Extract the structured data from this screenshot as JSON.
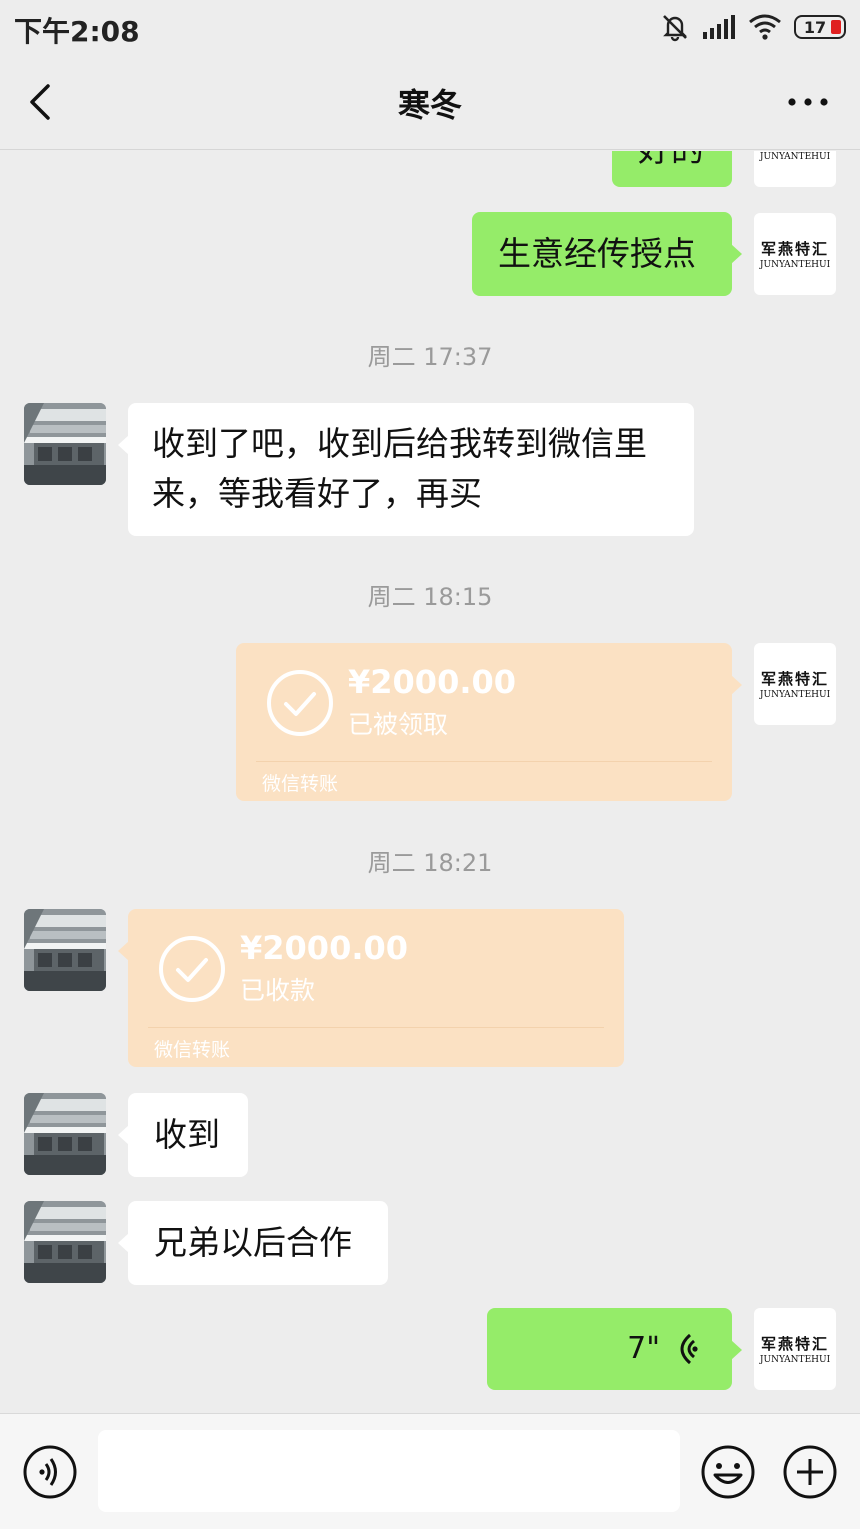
{
  "status_bar": {
    "time": "下午2:08",
    "battery": "17",
    "icons": [
      "mute-bell-icon",
      "signal-icon",
      "wifi-icon",
      "battery-icon"
    ]
  },
  "header": {
    "title": "寒冬",
    "back_icon": "chevron-left-icon",
    "more_icon": "more-dots-icon"
  },
  "contact_avatar": {
    "cn": "军燕特汇",
    "en": "JUNYANTEHUI"
  },
  "messages": {
    "partial_top": "好的",
    "m1": "生意经传授点",
    "ts1": "周二 17:37",
    "m2_line1": "收到了吧，收到后给我转到微信里",
    "m2_line2": "来，等我看好了，再买",
    "ts2": "周二 18:15",
    "transfer1": {
      "amount": "¥2000.00",
      "status": "已被领取",
      "label": "微信转账"
    },
    "ts3": "周二 18:21",
    "transfer2": {
      "amount": "¥2000.00",
      "status": "已收款",
      "label": "微信转账"
    },
    "m3": "收到",
    "m4": "兄弟以后合作",
    "voice": {
      "duration": "7\""
    }
  },
  "input_bar": {
    "placeholder": "",
    "icons": [
      "voice-icon",
      "emoji-icon",
      "plus-icon"
    ]
  },
  "colors": {
    "background": "#ededed",
    "bubble_green": "#95ec69",
    "bubble_white": "#ffffff",
    "transfer": "#fbe1c3"
  }
}
